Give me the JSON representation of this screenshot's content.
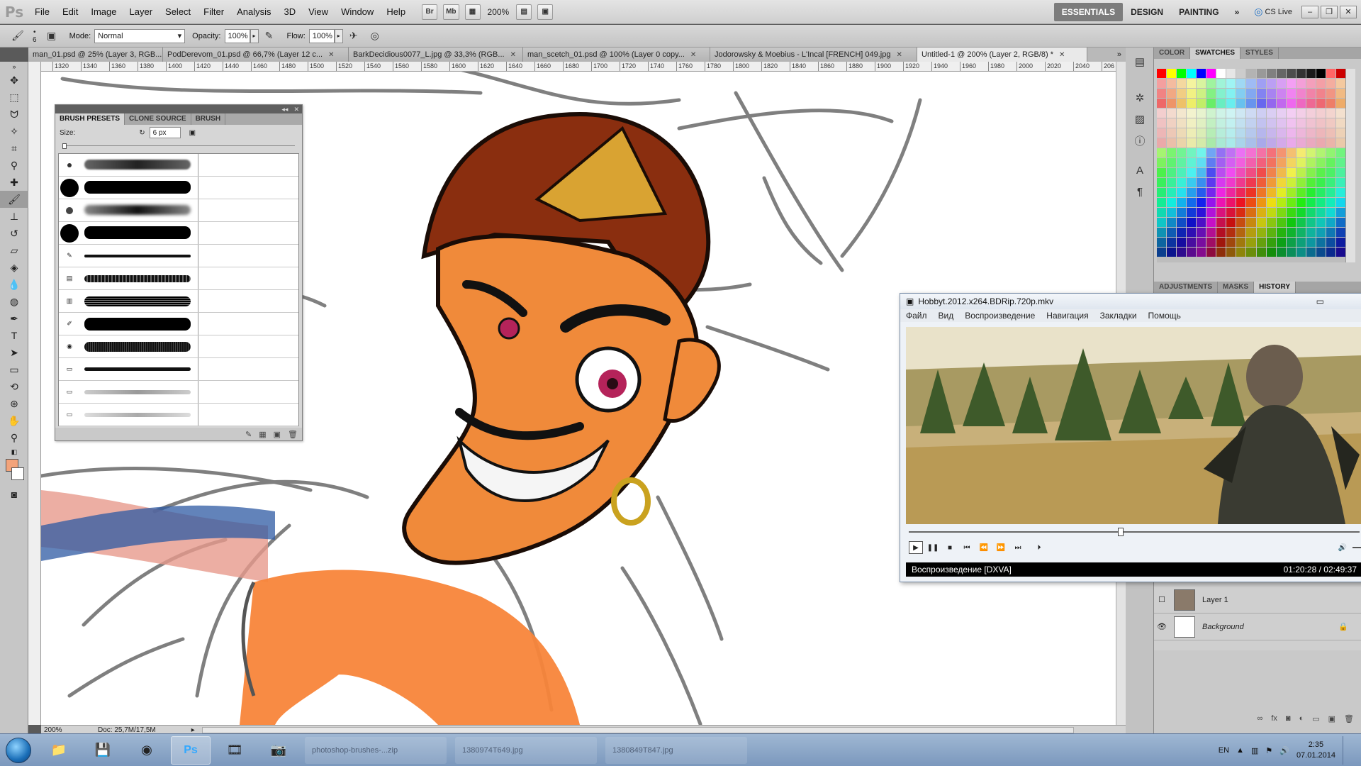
{
  "menubar": {
    "logo": "Ps",
    "items": [
      "File",
      "Edit",
      "Image",
      "Layer",
      "Select",
      "Filter",
      "Analysis",
      "3D",
      "View",
      "Window",
      "Help"
    ],
    "br_label": "Br",
    "mb_label": "Mb",
    "zoom": "200%",
    "workspaces": [
      "ESSENTIALS",
      "DESIGN",
      "PAINTING"
    ],
    "more": "»",
    "cs_live": "CS Live"
  },
  "options": {
    "brush_size": "6",
    "mode_label": "Mode:",
    "mode_value": "Normal",
    "opacity_label": "Opacity:",
    "opacity_value": "100%",
    "flow_label": "Flow:",
    "flow_value": "100%"
  },
  "tabs": [
    {
      "label": "man_01.psd @ 25% (Layer 3, RGB..."
    },
    {
      "label": "PodDerevom_01.psd @ 66,7% (Layer 12 c..."
    },
    {
      "label": "BarkDecidious0077_L.jpg @ 33,3% (RGB..."
    },
    {
      "label": "man_scetch_01.psd @ 100% (Layer 0 copy..."
    },
    {
      "label": "Jodorowsky & Moebius - L'Incal [FRENCH] 049.jpg"
    },
    {
      "label": "Untitled-1 @ 200% (Layer 2, RGB/8) *"
    }
  ],
  "ruler": {
    "ticks": [
      "1320",
      "1340",
      "1360",
      "1380",
      "1400",
      "1420",
      "1440",
      "1460",
      "1480",
      "1500",
      "1520",
      "1540",
      "1560",
      "1580",
      "1600",
      "1620",
      "1640",
      "1660",
      "1680",
      "1700",
      "1720",
      "1740",
      "1760",
      "1780",
      "1800",
      "1820",
      "1840",
      "1860",
      "1880",
      "1900",
      "1920",
      "1940",
      "1960",
      "1980",
      "2000",
      "2020",
      "2040",
      "206"
    ]
  },
  "status": {
    "zoom": "200%",
    "doc": "Doc: 25,7M/17,5M"
  },
  "brush_panel": {
    "tabs": [
      "BRUSH PRESETS",
      "CLONE SOURCE",
      "BRUSH"
    ],
    "size_label": "Size:",
    "size_value": "6 px"
  },
  "right_panel": {
    "top_tabs": [
      "COLOR",
      "SWATCHES",
      "STYLES"
    ],
    "mid_tabs": [
      "ADJUSTMENTS",
      "MASKS",
      "HISTORY"
    ],
    "layers": [
      {
        "name": "Layer 1",
        "visible": false
      },
      {
        "name": "Background",
        "visible": true,
        "locked": true
      }
    ],
    "swatch_colors": [
      "#ff0000",
      "#ffff00",
      "#00ff00",
      "#00ffff",
      "#0000ff",
      "#ff00ff",
      "#ffffff",
      "#e6e6e6",
      "#cccccc",
      "#b3b3b3",
      "#999999",
      "#808080",
      "#666666",
      "#4d4d4d",
      "#333333",
      "#1a1a1a",
      "#000000",
      "#ff6666",
      "#cc0000"
    ]
  },
  "player": {
    "title": "Hobbyt.2012.x264.BDRip.720p.mkv",
    "menu": [
      "Файл",
      "Вид",
      "Воспроизведение",
      "Навигация",
      "Закладки",
      "Помощь"
    ],
    "status": "Воспроизведение [DXVA]",
    "time": "01:20:28 / 02:49:37",
    "progress": 0.47
  },
  "taskbar": {
    "windows": [
      "photoshop-brushes-...zip",
      "1380974T649.jpg",
      "1380849T847.jpg"
    ],
    "lang": "EN",
    "time": "2:35",
    "date": "07.01.2014"
  }
}
